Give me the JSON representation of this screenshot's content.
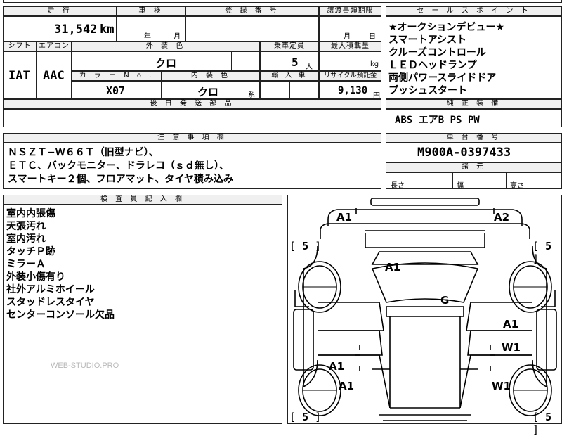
{
  "header": {
    "mileage_label": "走 行",
    "inspection_label": "車 検",
    "registration_label": "登 録 番 号",
    "transfer_deadline_label": "譲渡書類期限",
    "selling_points_label": "セ ー ル ス ポ イ ン ト"
  },
  "mileage": {
    "value": "31,542",
    "unit": "km"
  },
  "inspection": {
    "year_unit": "年",
    "month_unit": "月"
  },
  "transfer": {
    "month_unit": "月",
    "day_unit": "日"
  },
  "specs": {
    "shift_label": "シフト",
    "ac_label": "エアコン",
    "exterior_color_label": "外 装 色",
    "capacity_label": "乗車定員",
    "max_load_label": "最大積載量",
    "shift_value": "IAT",
    "ac_value": "AAC",
    "exterior_color_value": "クロ",
    "capacity_value": "5",
    "capacity_unit": "人",
    "load_unit": "kg",
    "color_no_label": "カ ラ ー N o .",
    "interior_color_label": "内 装 色",
    "import_label": "輸 入 車",
    "recycle_label": "リサイクル預託金",
    "color_no_value": "X07",
    "interior_color_value": "クロ",
    "interior_suffix": "系",
    "recycle_value": "9,130",
    "recycle_unit": "円",
    "later_parts_label": "後 日 発 送 部 品"
  },
  "selling_points": [
    "★オークションデビュー★",
    "スマートアシスト",
    "クルーズコントロール",
    "ＬＥＤヘッドランプ",
    "両側パワースライドドア",
    "プッシュスタート"
  ],
  "equipment": {
    "label": "純 正 装 備",
    "value": "ABS エアB PS PW"
  },
  "notes": {
    "label": "注 意 事 項 欄",
    "lines": [
      "ＮＳＺＴ−Ｗ６６Ｔ（旧型ナビ）、",
      "ＥＴＣ、バックモニター、ドラレコ（ｓｄ無し）、",
      "スマートキー２個、フロアマット、タイヤ積み込み"
    ]
  },
  "chassis": {
    "label": "車 台 番 号",
    "value": "M900A-0397433",
    "dims_label": "諸 元",
    "length_label": "長さ",
    "width_label": "幅",
    "height_label": "高さ"
  },
  "inspector": {
    "label": "検 査 員 記 入 欄",
    "lines": [
      "室内内張傷",
      "天張汚れ",
      "室内汚れ",
      "タッチＰ跡",
      "ミラーＡ",
      "外装小傷有り",
      "社外アルミホイール",
      "スタッドレスタイヤ",
      "センターコンソール欠品"
    ]
  },
  "diagram": {
    "marks": {
      "front_left": "A1",
      "front_right": "A2",
      "hood": "A1",
      "roof": "G",
      "right_front_door": "A1",
      "right_rear_door": "W1",
      "left_rear_door": "A1",
      "left_rear": "A1",
      "right_rear": "W1"
    },
    "tires": {
      "front_left": "5",
      "front_right": "5",
      "rear_left": "5",
      "rear_right": "5"
    }
  },
  "watermark": "WEB-STUDIO.PRO"
}
